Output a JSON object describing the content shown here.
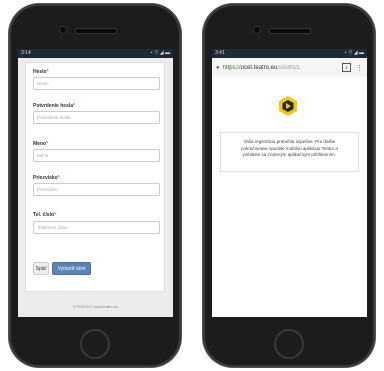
{
  "left_phone": {
    "status": {
      "time": "3:14",
      "icons": "⋆ ▽ ◢ ▬"
    },
    "fields": [
      {
        "label": "Heslo",
        "placeholder": "Heslo"
      },
      {
        "label": "Potvrdenie hesla",
        "placeholder": "Potvrdenie hesla"
      },
      {
        "label": "Meno",
        "placeholder": "Meno"
      },
      {
        "label": "Priezvisko",
        "placeholder": "Priezvisko"
      },
      {
        "label": "Tel. číslo",
        "placeholder": "Telefónne číslo"
      }
    ],
    "required_mark": "*",
    "back_button": "Späť",
    "create_button": "Vytvoriť účet",
    "footer": "©TEATRO www.teatro.eu"
  },
  "right_phone": {
    "status": {
      "time": "3:41",
      "icons": "⋆ ▽ ◢ ▬"
    },
    "url_proto": "https://",
    "url_host": "ucet.teatro.eu",
    "url_path": "/south21",
    "tab_count": "1",
    "menu": "⋮",
    "message": "Vaša registrácia prebehla úspešne. Pre ďalšie pokračovanie spustite mobilnú aplikáciu Teatro a prihláste sa zvoleným aplikačným prihlásením."
  },
  "colors": {
    "primary": "#5b83b8",
    "required": "#d9534f",
    "logo_yellow": "#f5c518",
    "logo_dark": "#1f2a36"
  }
}
